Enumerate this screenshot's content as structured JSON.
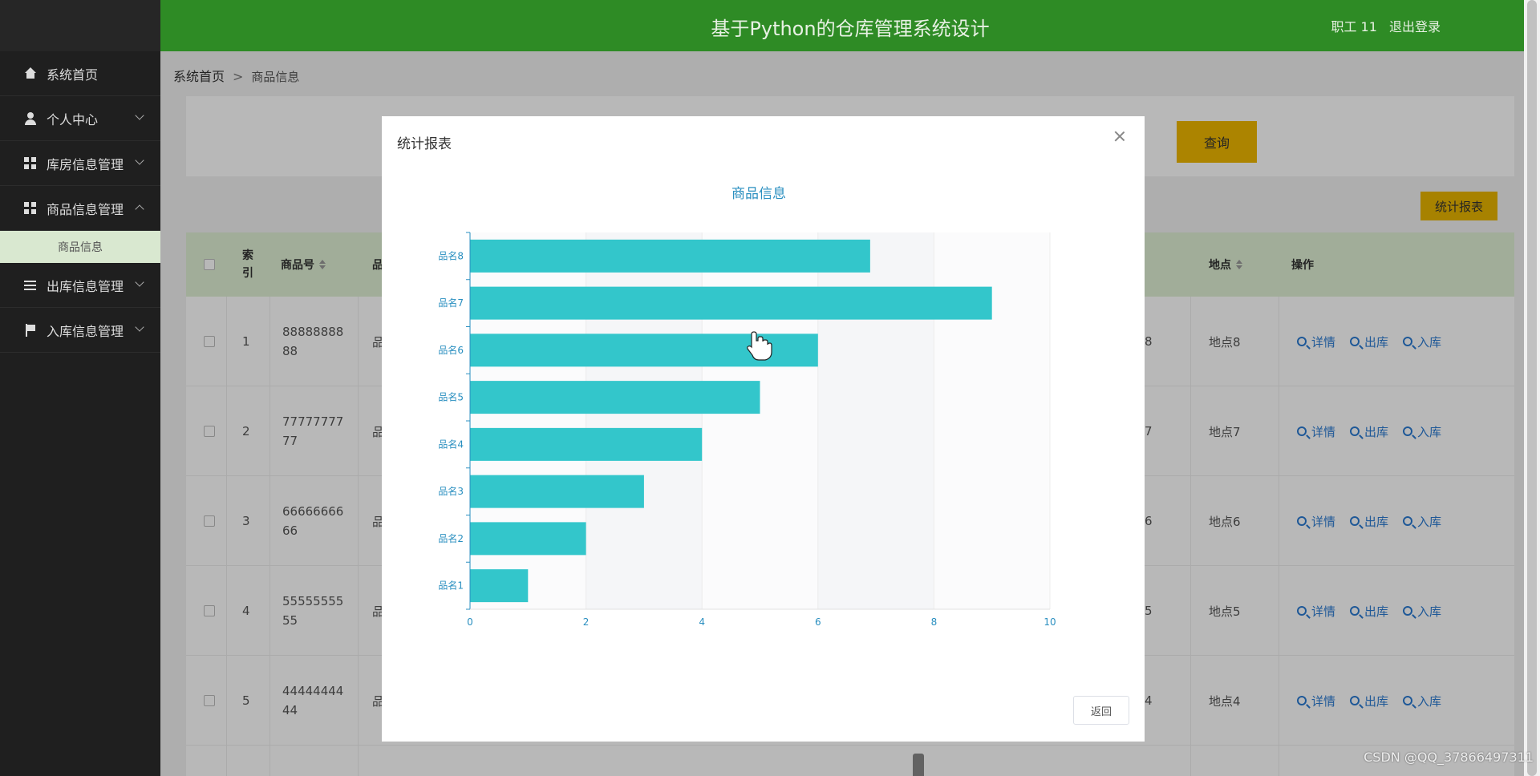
{
  "header": {
    "title": "基于Python的仓库管理系统设计",
    "user": "职工 11",
    "logout": "退出登录"
  },
  "sidebar": {
    "items": [
      {
        "label": "系统首页",
        "icon": "home-icon"
      },
      {
        "label": "个人中心",
        "icon": "user-icon"
      },
      {
        "label": "库房信息管理",
        "icon": "grid-icon"
      },
      {
        "label": "商品信息管理",
        "icon": "grid-icon",
        "expanded": true
      },
      {
        "label": "出库信息管理",
        "icon": "list-icon"
      },
      {
        "label": "入库信息管理",
        "icon": "flag-icon"
      }
    ],
    "sub_item": "商品信息"
  },
  "breadcrumb": {
    "home": "系统首页",
    "sep": ">",
    "current": "商品信息"
  },
  "toolbar": {
    "query": "查询",
    "report": "统计报表"
  },
  "table": {
    "headers": {
      "index": "索引",
      "code": "商品号",
      "code_cut": "品",
      "location": "地点",
      "action": "操作"
    },
    "rows": [
      {
        "index": "1",
        "code": "8888888888",
        "cut": "品",
        "cut2": "8",
        "location": "地点8"
      },
      {
        "index": "2",
        "code": "7777777777",
        "cut": "品",
        "cut2": "7",
        "location": "地点7"
      },
      {
        "index": "3",
        "code": "6666666666",
        "cut": "品",
        "cut2": "6",
        "location": "地点6"
      },
      {
        "index": "4",
        "code": "5555555555",
        "cut": "品",
        "cut2": "5",
        "location": "地点5"
      },
      {
        "index": "5",
        "code": "4444444444",
        "cut": "品",
        "cut2": "4",
        "location": "地点4"
      }
    ],
    "actions": {
      "detail": "详情",
      "out": "出库",
      "in": "入库"
    }
  },
  "modal": {
    "title": "统计报表",
    "return": "返回"
  },
  "chart_data": {
    "type": "bar",
    "orientation": "horizontal",
    "title": "商品信息",
    "categories": [
      "品名1",
      "品名2",
      "品名3",
      "品名4",
      "品名5",
      "品名6",
      "品名7",
      "品名8"
    ],
    "values": [
      1,
      2,
      3,
      4,
      5,
      6,
      9,
      6.9
    ],
    "xlim": [
      0,
      10
    ],
    "xticks": [
      0,
      2,
      4,
      6,
      8,
      10
    ],
    "bar_color": "#33c6cb",
    "label_color": "#2a8fc0"
  },
  "watermark": "CSDN @QQ_37866497311"
}
